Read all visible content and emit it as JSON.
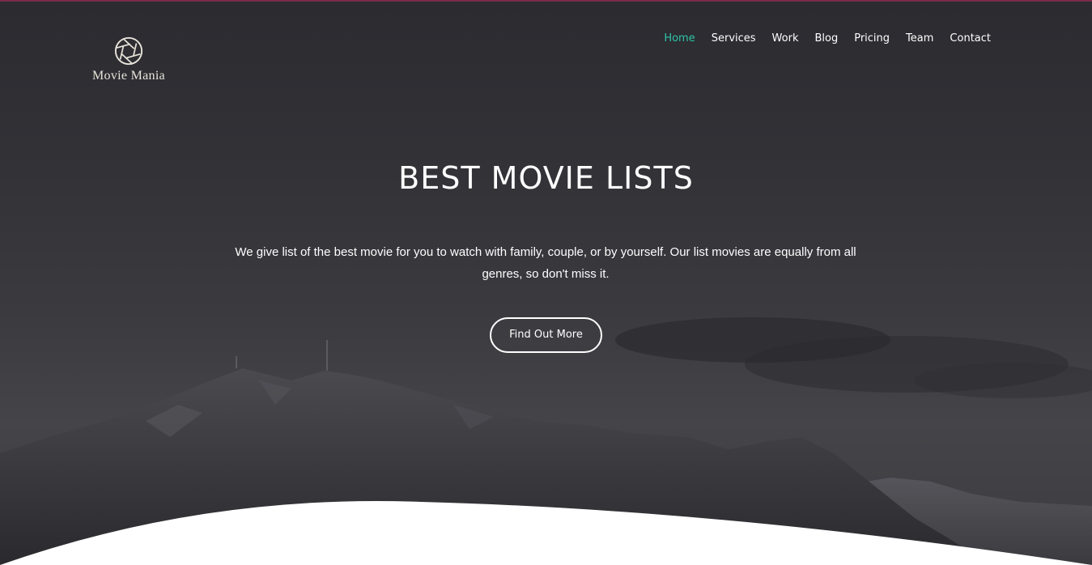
{
  "brand": {
    "logo_icon": "camera-aperture-icon",
    "name": "Movie Mania"
  },
  "nav": {
    "items": [
      {
        "label": "Home",
        "active": true
      },
      {
        "label": "Services",
        "active": false
      },
      {
        "label": "Work",
        "active": false
      },
      {
        "label": "Blog",
        "active": false
      },
      {
        "label": "Pricing",
        "active": false
      },
      {
        "label": "Team",
        "active": false
      },
      {
        "label": "Contact",
        "active": false
      }
    ]
  },
  "hero": {
    "title": "BEST MOVIE LISTS",
    "description": "We give list of the best movie for you to watch with family, couple, or by yourself. Our list movies are equally from all genres, so don't miss it.",
    "cta_label": "Find Out More"
  },
  "colors": {
    "accent": "#2fc4a6",
    "top_border": "#7a2a4a",
    "logo": "#e8e4da"
  }
}
